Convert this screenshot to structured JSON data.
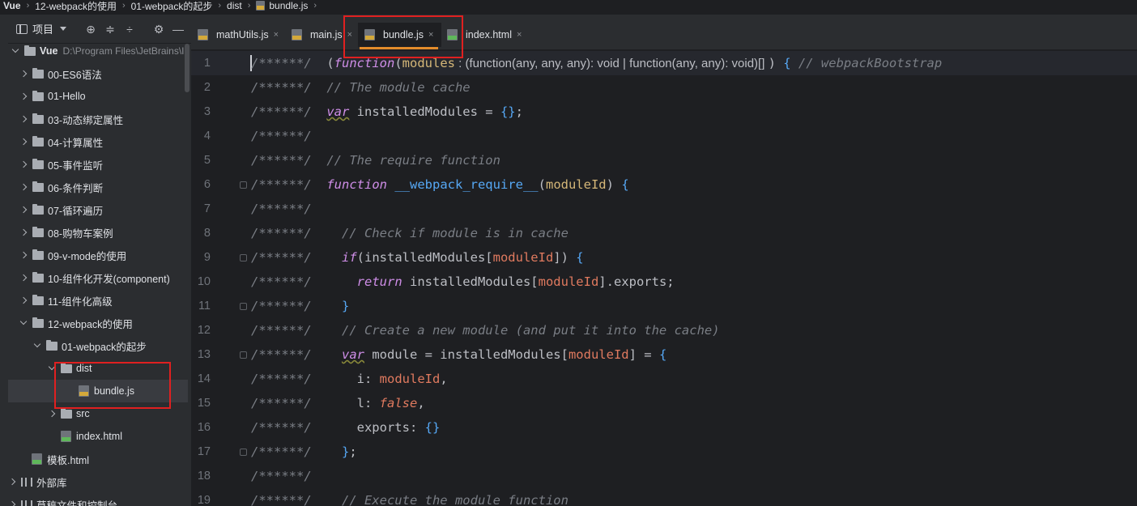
{
  "breadcrumb": {
    "items": [
      "Vue",
      "12-webpack的使用",
      "01-webpack的起步",
      "dist",
      "bundle.js"
    ]
  },
  "sidebar": {
    "toolbar_label": "项目",
    "toolbar_icons": [
      "locate-icon",
      "expand-all-icon",
      "collapse-all-icon",
      "gear-icon",
      "minimize-icon"
    ],
    "root": {
      "name": "Vue",
      "path": "D:\\Program Files\\JetBrains\\I"
    },
    "items": [
      {
        "label": "00-ES6语法"
      },
      {
        "label": "01-Hello"
      },
      {
        "label": "03-动态绑定属性"
      },
      {
        "label": "04-计算属性"
      },
      {
        "label": "05-事件监听"
      },
      {
        "label": "06-条件判断"
      },
      {
        "label": "07-循环遍历"
      },
      {
        "label": "08-购物车案例"
      },
      {
        "label": "09-v-mode的使用"
      },
      {
        "label": "10-组件化开发(component)"
      },
      {
        "label": "11-组件化高级"
      },
      {
        "label": "12-webpack的使用"
      },
      {
        "label": "01-webpack的起步"
      },
      {
        "label": "dist"
      },
      {
        "label": "bundle.js"
      },
      {
        "label": "src"
      },
      {
        "label": "index.html"
      },
      {
        "label": "模板.html"
      },
      {
        "label": "外部库"
      },
      {
        "label": "草稿文件和控制台"
      }
    ]
  },
  "tabs": [
    {
      "label": "mathUtils.js",
      "close": "×"
    },
    {
      "label": "main.js",
      "close": "×"
    },
    {
      "label": "bundle.js",
      "close": "×"
    },
    {
      "label": "index.html",
      "close": "×"
    }
  ],
  "editor": {
    "line_numbers": [
      "1",
      "2",
      "3",
      "4",
      "5",
      "6",
      "7",
      "8",
      "9",
      "10",
      "11",
      "12",
      "13",
      "14",
      "15",
      "16",
      "17",
      "18",
      "19"
    ],
    "prefix": "/******/",
    "l1_hint": " : (function(any, any, any): void | function(any, any): void)[] ",
    "l1_comment": "// webpackBootstrap",
    "l2_comment": "// The module cache",
    "l5_comment": "// The require function",
    "l8_comment": "// Check if module is in cache",
    "l12_comment": "// Create a new module (and put it into the cache)",
    "l19_comment": "// Execute the module function"
  },
  "colors": {
    "accent": "#e38c2b",
    "annotation": "#e02020"
  }
}
